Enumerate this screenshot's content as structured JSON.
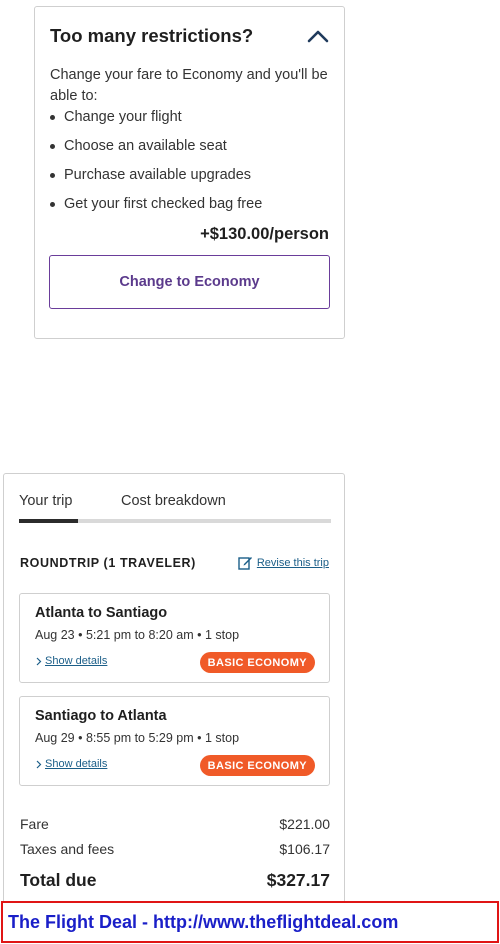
{
  "restrictions": {
    "title": "Too many restrictions?",
    "intro": "Change your fare to Economy and you'll be able to:",
    "benefits": [
      "Change your flight",
      "Choose an available seat",
      "Purchase available upgrades",
      "Get your first checked bag free"
    ],
    "price": "+$130.00/person",
    "button_label": "Change to Economy",
    "toggle_icon": "chevron-up-icon"
  },
  "trip": {
    "tabs": [
      "Your trip",
      "Cost breakdown"
    ],
    "active_tab": "Your trip",
    "heading": "ROUNDTRIP (1 TRAVELER)",
    "revise_label": "Revise this trip",
    "flights": [
      {
        "route": "Atlanta to Santiago",
        "times": "Aug 23 • 5:21 pm to 8:20 am • 1 stop",
        "details_label": "Show details",
        "fare_badge": "BASIC ECONOMY"
      },
      {
        "route": "Santiago to Atlanta",
        "times": "Aug 29 • 8:55 pm to 5:29 pm • 1 stop",
        "details_label": "Show details",
        "fare_badge": "BASIC ECONOMY"
      }
    ],
    "costs": {
      "fare_label": "Fare",
      "fare_value": "$221.00",
      "taxes_label": "Taxes and fees",
      "taxes_value": "$106.17",
      "total_label": "Total due",
      "total_value": "$327.17"
    }
  },
  "banner": {
    "text": "The Flight Deal - http://www.theflightdeal.com"
  },
  "colors": {
    "accent_purple": "#5b3a8c",
    "badge_orange": "#f05a28",
    "link_blue": "#1b5e88",
    "banner_border": "#e01515",
    "banner_text": "#1a1fc8"
  }
}
